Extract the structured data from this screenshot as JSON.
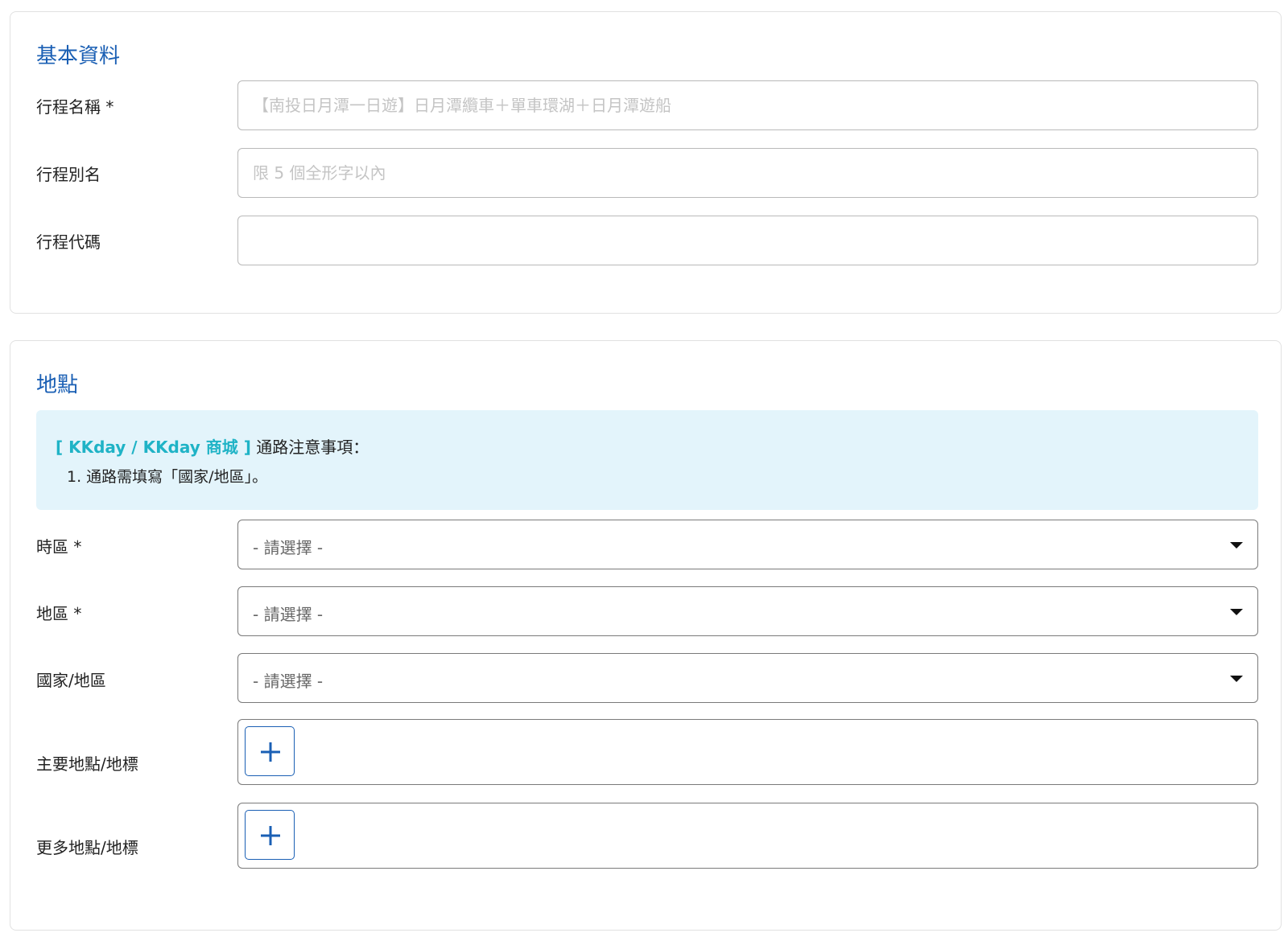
{
  "basic_info": {
    "title": "基本資料",
    "fields": [
      {
        "label": "行程名稱 *",
        "value": "",
        "placeholder": "【南投日月潭一日遊】日月潭纜車＋單車環湖＋日月潭遊船"
      },
      {
        "label": "行程別名",
        "value": "",
        "placeholder": "限 5 個全形字以內"
      },
      {
        "label": "行程代碼",
        "value": "",
        "placeholder": ""
      }
    ]
  },
  "location": {
    "title": "地點",
    "notice": {
      "channel": "[ KKday / KKday 商城 ]",
      "heading": " 通路注意事項：",
      "item1": "1. 通路需填寫「國家/地區」。"
    },
    "selects": [
      {
        "label": "時區 *",
        "value": "- 請選擇 -"
      },
      {
        "label": "地區 *",
        "value": "- 請選擇 -"
      },
      {
        "label": "國家/地區",
        "value": "- 請選擇 -"
      }
    ],
    "adders": [
      {
        "label": "主要地點/地標",
        "icon": "plus-icon"
      },
      {
        "label": "更多地點/地標",
        "icon": "plus-icon"
      }
    ]
  },
  "colors": {
    "accent": "#1a5fb4",
    "notice_bg": "#e3f4fb",
    "channel_text": "#1fb3c6"
  }
}
